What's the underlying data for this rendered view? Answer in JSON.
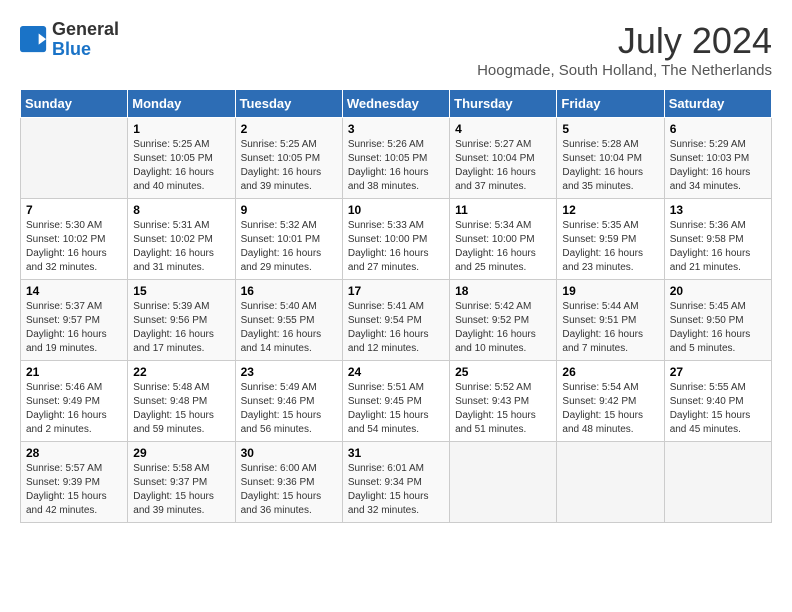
{
  "header": {
    "logo": {
      "general": "General",
      "blue": "Blue"
    },
    "month": "July 2024",
    "location": "Hoogmade, South Holland, The Netherlands"
  },
  "days_of_week": [
    "Sunday",
    "Monday",
    "Tuesday",
    "Wednesday",
    "Thursday",
    "Friday",
    "Saturday"
  ],
  "weeks": [
    [
      {
        "day": "",
        "info": ""
      },
      {
        "day": "1",
        "info": "Sunrise: 5:25 AM\nSunset: 10:05 PM\nDaylight: 16 hours\nand 40 minutes."
      },
      {
        "day": "2",
        "info": "Sunrise: 5:25 AM\nSunset: 10:05 PM\nDaylight: 16 hours\nand 39 minutes."
      },
      {
        "day": "3",
        "info": "Sunrise: 5:26 AM\nSunset: 10:05 PM\nDaylight: 16 hours\nand 38 minutes."
      },
      {
        "day": "4",
        "info": "Sunrise: 5:27 AM\nSunset: 10:04 PM\nDaylight: 16 hours\nand 37 minutes."
      },
      {
        "day": "5",
        "info": "Sunrise: 5:28 AM\nSunset: 10:04 PM\nDaylight: 16 hours\nand 35 minutes."
      },
      {
        "day": "6",
        "info": "Sunrise: 5:29 AM\nSunset: 10:03 PM\nDaylight: 16 hours\nand 34 minutes."
      }
    ],
    [
      {
        "day": "7",
        "info": "Sunrise: 5:30 AM\nSunset: 10:02 PM\nDaylight: 16 hours\nand 32 minutes."
      },
      {
        "day": "8",
        "info": "Sunrise: 5:31 AM\nSunset: 10:02 PM\nDaylight: 16 hours\nand 31 minutes."
      },
      {
        "day": "9",
        "info": "Sunrise: 5:32 AM\nSunset: 10:01 PM\nDaylight: 16 hours\nand 29 minutes."
      },
      {
        "day": "10",
        "info": "Sunrise: 5:33 AM\nSunset: 10:00 PM\nDaylight: 16 hours\nand 27 minutes."
      },
      {
        "day": "11",
        "info": "Sunrise: 5:34 AM\nSunset: 10:00 PM\nDaylight: 16 hours\nand 25 minutes."
      },
      {
        "day": "12",
        "info": "Sunrise: 5:35 AM\nSunset: 9:59 PM\nDaylight: 16 hours\nand 23 minutes."
      },
      {
        "day": "13",
        "info": "Sunrise: 5:36 AM\nSunset: 9:58 PM\nDaylight: 16 hours\nand 21 minutes."
      }
    ],
    [
      {
        "day": "14",
        "info": "Sunrise: 5:37 AM\nSunset: 9:57 PM\nDaylight: 16 hours\nand 19 minutes."
      },
      {
        "day": "15",
        "info": "Sunrise: 5:39 AM\nSunset: 9:56 PM\nDaylight: 16 hours\nand 17 minutes."
      },
      {
        "day": "16",
        "info": "Sunrise: 5:40 AM\nSunset: 9:55 PM\nDaylight: 16 hours\nand 14 minutes."
      },
      {
        "day": "17",
        "info": "Sunrise: 5:41 AM\nSunset: 9:54 PM\nDaylight: 16 hours\nand 12 minutes."
      },
      {
        "day": "18",
        "info": "Sunrise: 5:42 AM\nSunset: 9:52 PM\nDaylight: 16 hours\nand 10 minutes."
      },
      {
        "day": "19",
        "info": "Sunrise: 5:44 AM\nSunset: 9:51 PM\nDaylight: 16 hours\nand 7 minutes."
      },
      {
        "day": "20",
        "info": "Sunrise: 5:45 AM\nSunset: 9:50 PM\nDaylight: 16 hours\nand 5 minutes."
      }
    ],
    [
      {
        "day": "21",
        "info": "Sunrise: 5:46 AM\nSunset: 9:49 PM\nDaylight: 16 hours\nand 2 minutes."
      },
      {
        "day": "22",
        "info": "Sunrise: 5:48 AM\nSunset: 9:48 PM\nDaylight: 15 hours\nand 59 minutes."
      },
      {
        "day": "23",
        "info": "Sunrise: 5:49 AM\nSunset: 9:46 PM\nDaylight: 15 hours\nand 56 minutes."
      },
      {
        "day": "24",
        "info": "Sunrise: 5:51 AM\nSunset: 9:45 PM\nDaylight: 15 hours\nand 54 minutes."
      },
      {
        "day": "25",
        "info": "Sunrise: 5:52 AM\nSunset: 9:43 PM\nDaylight: 15 hours\nand 51 minutes."
      },
      {
        "day": "26",
        "info": "Sunrise: 5:54 AM\nSunset: 9:42 PM\nDaylight: 15 hours\nand 48 minutes."
      },
      {
        "day": "27",
        "info": "Sunrise: 5:55 AM\nSunset: 9:40 PM\nDaylight: 15 hours\nand 45 minutes."
      }
    ],
    [
      {
        "day": "28",
        "info": "Sunrise: 5:57 AM\nSunset: 9:39 PM\nDaylight: 15 hours\nand 42 minutes."
      },
      {
        "day": "29",
        "info": "Sunrise: 5:58 AM\nSunset: 9:37 PM\nDaylight: 15 hours\nand 39 minutes."
      },
      {
        "day": "30",
        "info": "Sunrise: 6:00 AM\nSunset: 9:36 PM\nDaylight: 15 hours\nand 36 minutes."
      },
      {
        "day": "31",
        "info": "Sunrise: 6:01 AM\nSunset: 9:34 PM\nDaylight: 15 hours\nand 32 minutes."
      },
      {
        "day": "",
        "info": ""
      },
      {
        "day": "",
        "info": ""
      },
      {
        "day": "",
        "info": ""
      }
    ]
  ]
}
